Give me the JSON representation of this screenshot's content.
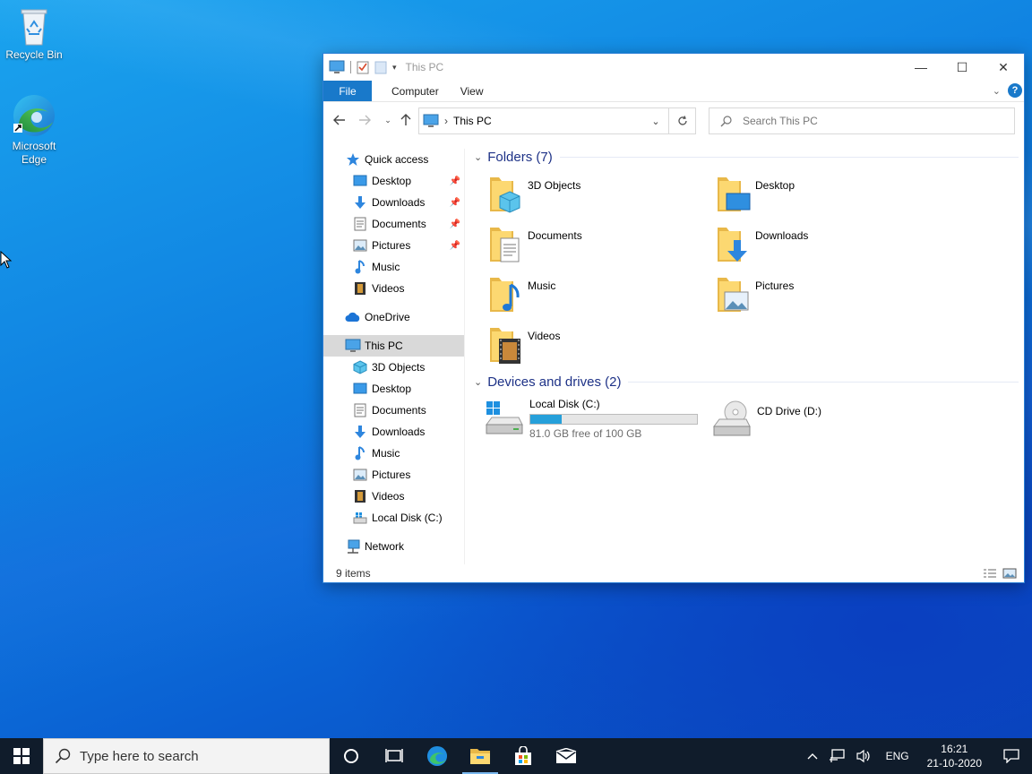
{
  "desktop": {
    "icons": [
      {
        "label": "Recycle Bin",
        "icon": "recycle-bin-icon"
      },
      {
        "label": "Microsoft Edge",
        "icon": "edge-icon"
      }
    ]
  },
  "window": {
    "title": "This PC",
    "controls": {
      "minimize": "—",
      "maximize": "☐",
      "close": "✕"
    },
    "ribbon": {
      "tabs": [
        {
          "label": "File",
          "active": true
        },
        {
          "label": "Computer"
        },
        {
          "label": "View"
        }
      ],
      "help": "?"
    },
    "address": {
      "path": "This PC"
    },
    "search": {
      "placeholder": "Search This PC"
    },
    "nav": {
      "quick_access": {
        "label": "Quick access",
        "items": [
          {
            "label": "Desktop",
            "icon": "desktop-folder-icon",
            "pinned": true
          },
          {
            "label": "Downloads",
            "icon": "downloads-folder-icon",
            "pinned": true
          },
          {
            "label": "Documents",
            "icon": "documents-folder-icon",
            "pinned": true
          },
          {
            "label": "Pictures",
            "icon": "pictures-folder-icon",
            "pinned": true
          },
          {
            "label": "Music",
            "icon": "music-folder-icon",
            "pinned": false
          },
          {
            "label": "Videos",
            "icon": "videos-folder-icon",
            "pinned": false
          }
        ]
      },
      "onedrive": {
        "label": "OneDrive"
      },
      "this_pc": {
        "label": "This PC",
        "items": [
          {
            "label": "3D Objects",
            "icon": "3d-objects-icon"
          },
          {
            "label": "Desktop",
            "icon": "desktop-folder-icon"
          },
          {
            "label": "Documents",
            "icon": "documents-folder-icon"
          },
          {
            "label": "Downloads",
            "icon": "downloads-folder-icon"
          },
          {
            "label": "Music",
            "icon": "music-folder-icon"
          },
          {
            "label": "Pictures",
            "icon": "pictures-folder-icon"
          },
          {
            "label": "Videos",
            "icon": "videos-folder-icon"
          },
          {
            "label": "Local Disk (C:)",
            "icon": "local-disk-icon"
          }
        ]
      },
      "network": {
        "label": "Network"
      }
    },
    "content": {
      "folders_header": "Folders (7)",
      "folders": [
        {
          "label": "3D Objects",
          "icon": "3d-objects-icon"
        },
        {
          "label": "Desktop",
          "icon": "desktop-folder-icon"
        },
        {
          "label": "Documents",
          "icon": "documents-folder-icon"
        },
        {
          "label": "Downloads",
          "icon": "downloads-folder-icon"
        },
        {
          "label": "Music",
          "icon": "music-folder-icon"
        },
        {
          "label": "Pictures",
          "icon": "pictures-folder-icon"
        },
        {
          "label": "Videos",
          "icon": "videos-folder-icon"
        }
      ],
      "drives_header": "Devices and drives (2)",
      "drives": [
        {
          "label": "Local Disk (C:)",
          "free_text": "81.0 GB free of 100 GB",
          "used_fraction": 0.19,
          "icon": "local-disk-icon"
        },
        {
          "label": "CD Drive (D:)",
          "icon": "cd-drive-icon"
        }
      ]
    },
    "status": {
      "items": "9 items"
    }
  },
  "taskbar": {
    "search_placeholder": "Type here to search",
    "apps": [
      "cortana-icon",
      "task-view-icon",
      "edge-icon",
      "file-explorer-icon",
      "store-icon",
      "mail-icon"
    ],
    "tray": {
      "language": "ENG",
      "time": "16:21",
      "date": "21-10-2020"
    }
  },
  "colors": {
    "accent": "#1979ca",
    "group_header": "#1e3287",
    "drive_bar": "#26a0da",
    "taskbar": "#101c2b"
  }
}
